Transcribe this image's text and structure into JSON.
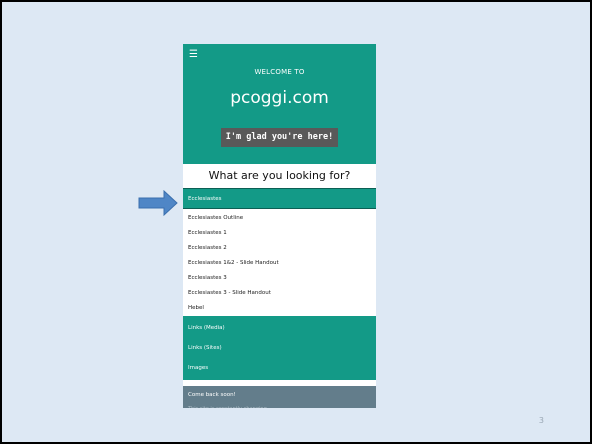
{
  "hero": {
    "menu_icon": "hamburger-icon",
    "welcome": "WELCOME TO",
    "site_name": "pcoggi.com",
    "button_label": "I'm glad you're here!"
  },
  "question": "What are you looking for?",
  "menu": {
    "active_section": "Ecclesiastes",
    "sub_items": [
      "Ecclesiastes Outline",
      "Ecclesiastes 1",
      "Ecclesiastes 2",
      "Ecclesiastes 1&2 - Slide Handout",
      "Ecclesiastes 3",
      "Ecclesiastes 3 - Slide Handout",
      "Hebel"
    ],
    "sections": [
      "Links (Media)",
      "Links (Sites)",
      "Images"
    ]
  },
  "footer": {
    "title": "Come back soon!",
    "subtitle": "This site is constantly changing"
  },
  "slide": {
    "number": "3"
  },
  "colors": {
    "teal": "#139a87",
    "button_gray": "#595959",
    "footer_gray": "#637d8b",
    "slide_bg": "#dde8f4",
    "arrow": "#4f86c6"
  },
  "annotations": {
    "pointer": "arrow-right-icon"
  }
}
